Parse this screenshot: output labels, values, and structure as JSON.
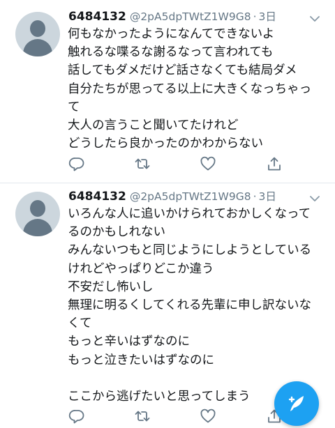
{
  "tweets": [
    {
      "name": "6484132",
      "handle": "@2pA5dpTWtZ1W9G8",
      "separator": "·",
      "time": "3日",
      "lines": [
        "何もなかったようになんてできないよ",
        "触れるな喋るな謝るなって言われても",
        "話してもダメだけど話さなくても結局ダメ",
        "自分たちが思ってる以上に大きくなっちゃっ",
        "て",
        "大人の言うこと聞いてたけれど",
        "どうしたら良かったのかわからない"
      ]
    },
    {
      "name": "6484132",
      "handle": "@2pA5dpTWtZ1W9G8",
      "separator": "·",
      "time": "3日",
      "lines": [
        "いろんな人に追いかけられておかしくなって",
        "るのかもしれない",
        "みんないつもと同じようにしようとしている",
        "けれどやっぱりどこか違う",
        "不安だし怖いし",
        "無理に明るくしてくれる先輩に申し訳ないな",
        "くて",
        "もっと辛いはずなのに",
        "もっと泣きたいはずなのに",
        "",
        "ここから逃げたいと思ってしまう"
      ]
    }
  ],
  "icons": {
    "reply": "reply-icon",
    "retweet": "retweet-icon",
    "like": "heart-icon",
    "share": "share-icon",
    "caret": "chevron-down-icon",
    "compose": "compose-tweet-icon"
  },
  "colors": {
    "accent": "#1da1f2",
    "text": "#14171a",
    "secondary": "#657786",
    "divider": "#e1e8ed"
  }
}
